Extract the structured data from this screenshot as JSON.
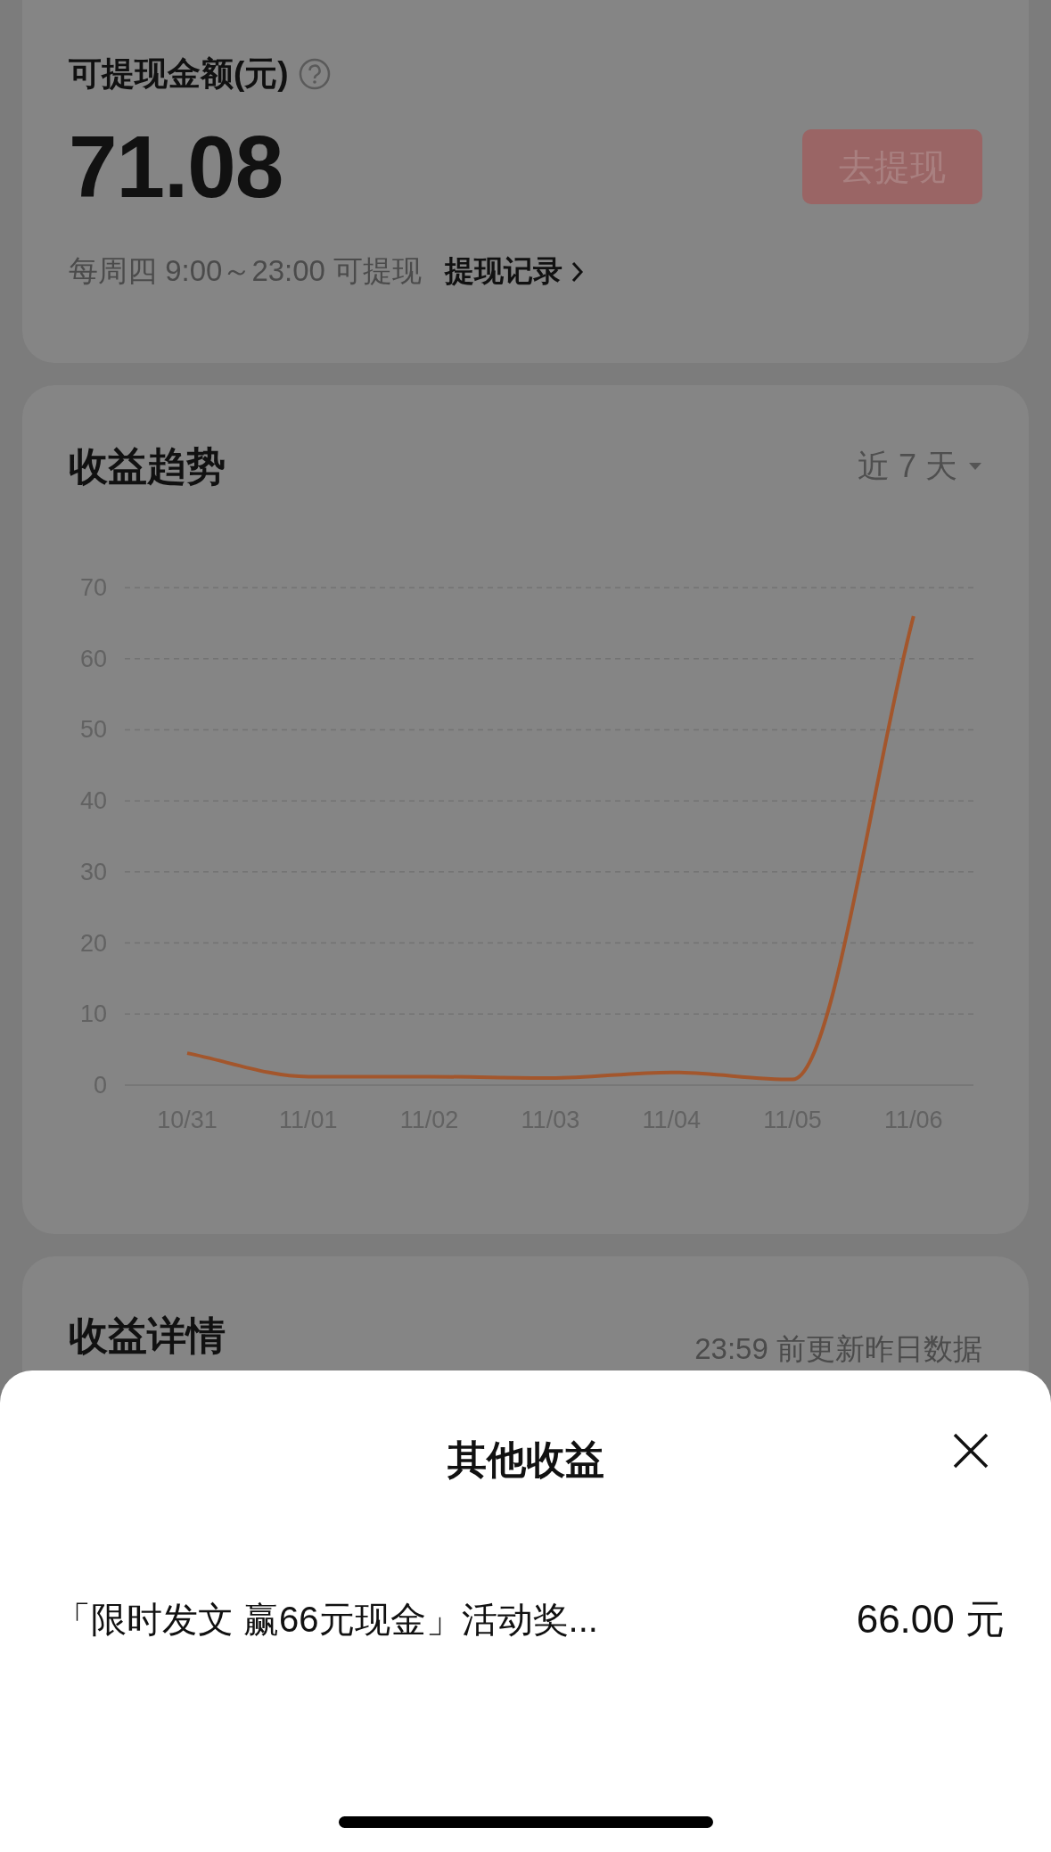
{
  "balance_card": {
    "label": "可提现金额(元)",
    "amount": "71.08",
    "withdraw_button": {
      "label": "去提现",
      "disabled": true
    },
    "schedule": "每周四 9:00～23:00 可提现",
    "records_link": "提现记录"
  },
  "trend_card": {
    "title": "收益趋势",
    "range": "近 7 天",
    "chart_data": {
      "type": "line",
      "categories": [
        "10/31",
        "11/01",
        "11/02",
        "11/03",
        "11/04",
        "11/05",
        "11/06"
      ],
      "series": [
        {
          "color": "#a3562c",
          "values": [
            4.5,
            1.2,
            1.2,
            1.0,
            1.8,
            0.8,
            66
          ]
        }
      ],
      "grid": true,
      "ylim": [
        0,
        70
      ],
      "yticks": [
        0,
        10,
        20,
        30,
        40,
        50,
        60,
        70
      ]
    }
  },
  "details_card": {
    "title": "收益详情",
    "note": "23:59 前更新昨日数据"
  },
  "sheet": {
    "title": "其他收益",
    "items": [
      {
        "label": "「限时发文 赢66元现金」活动奖...",
        "amount": "66.00 元"
      }
    ]
  }
}
